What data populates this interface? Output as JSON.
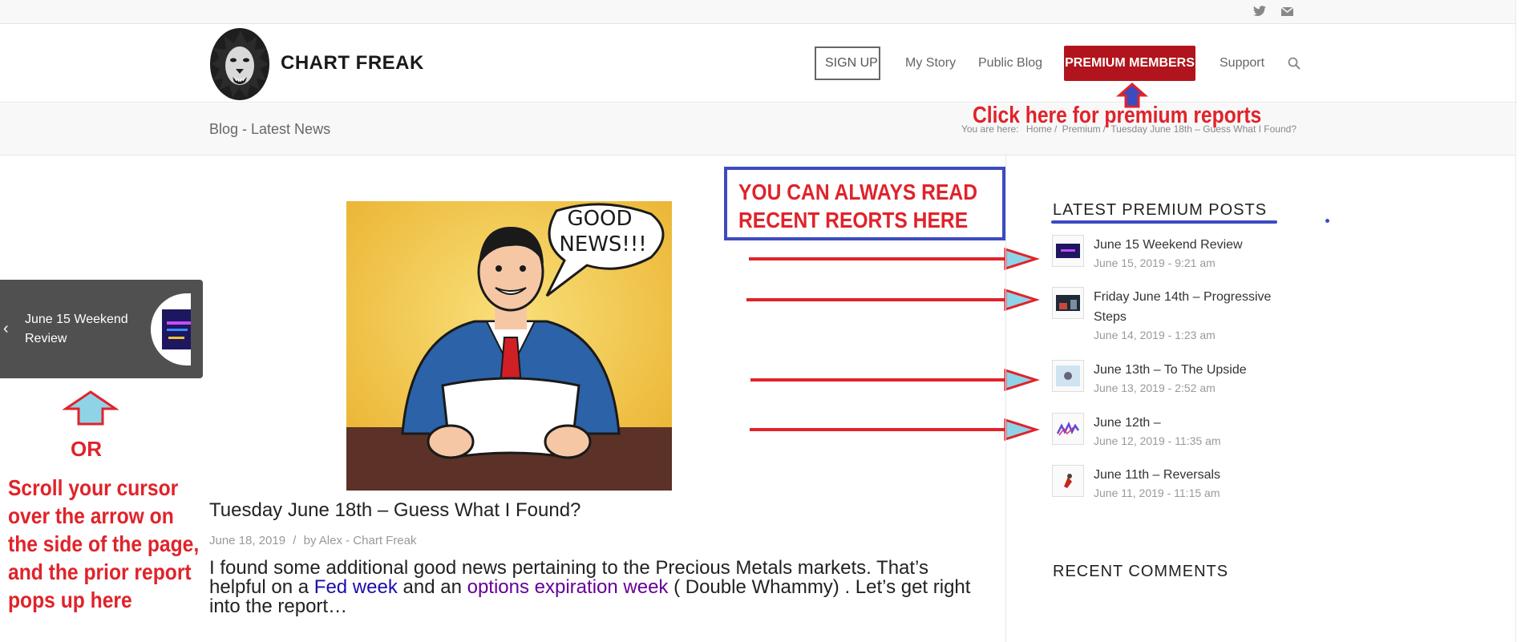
{
  "top_bar": {
    "icons": [
      "twitter-icon",
      "mail-icon"
    ]
  },
  "header": {
    "logo_text": "CHART FREAK",
    "nav": {
      "signup": "SIGN UP",
      "my_story": "My Story",
      "public_blog": "Public Blog",
      "premium": "PREMIUM MEMBERS",
      "support": "Support"
    }
  },
  "title_bar": {
    "title": "Blog - Latest News",
    "breadcrumb_prefix": "You are here:",
    "crumbs": [
      "Home",
      "Premium",
      "Tuesday June 18th – Guess What I Found?"
    ]
  },
  "annotations": {
    "premium_hint": "Click here for premium reports",
    "callout_line1": "YOU CAN ALWAYS READ",
    "callout_line2": "RECENT REORTS HERE",
    "or": "OR",
    "scroll_hint": [
      "Scroll your cursor",
      "over the arrow on",
      "the side of the page,",
      "and the prior report",
      "pops up here"
    ]
  },
  "hero": {
    "bubble_line1": "GOOD",
    "bubble_line2": "NEWS!!!"
  },
  "post": {
    "title": "Tuesday June 18th – Guess What I Found?",
    "date": "June 18, 2019",
    "sep": "/",
    "by": "by",
    "author": "Alex - Chart Freak",
    "excerpt_a": "I found some additional good news  pertaining to the Precious Metals markets. That’s helpful on a ",
    "excerpt_link1": "Fed week",
    "excerpt_b": " and an ",
    "excerpt_link2": "options expiration week",
    "excerpt_c": " ( Double Whammy) .  Let’s get right into the report…"
  },
  "sidebar": {
    "latest_title": "LATEST PREMIUM POSTS",
    "posts": [
      {
        "title": "June 15 Weekend Review",
        "date": "June 15, 2019 - 9:21 am"
      },
      {
        "title": "Friday June 14th – Progressive Steps",
        "date": "June 14, 2019 - 1:23 am"
      },
      {
        "title": "June 13th – To The Upside",
        "date": "June 13, 2019 - 2:52 am"
      },
      {
        "title": "June 12th –",
        "date": "June 12, 2019 - 11:35 am"
      },
      {
        "title": "June 11th – Reversals",
        "date": "June 11, 2019 - 11:15 am"
      }
    ],
    "comments_title": "RECENT COMMENTS"
  },
  "slideout": {
    "title": "June 15 Weekend Review",
    "arrow": "‹"
  },
  "colors": {
    "accent_red": "#b1141c",
    "annotation_red": "#e0232a",
    "annotation_blue": "#3c4bbf",
    "arrow_fill": "#8fd3e8"
  }
}
